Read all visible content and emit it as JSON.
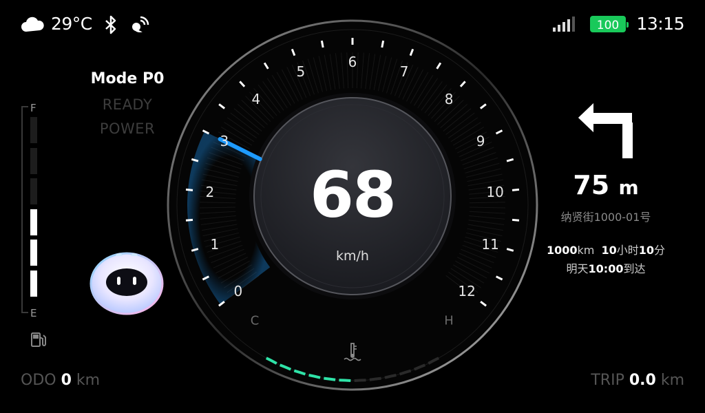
{
  "status": {
    "weather_icon": "cloud-icon",
    "temperature": "29°C",
    "bluetooth_icon": "bluetooth-icon",
    "signal_icon": "satellite-icon",
    "cell_icon": "cell-signal-icon",
    "battery": "100",
    "time": "13:15"
  },
  "drive": {
    "mode": "Mode P0",
    "ready": "READY",
    "power": "POWER"
  },
  "fuel": {
    "full_label": "F",
    "empty_label": "E",
    "level": 0.5,
    "segments_total": 6,
    "segments_on": 3
  },
  "gauge": {
    "speed": "68",
    "unit": "km/h",
    "scale": [
      "0",
      "1",
      "2",
      "3",
      "4",
      "5",
      "6",
      "7",
      "8",
      "9",
      "10",
      "11",
      "12"
    ],
    "needle_value": 3,
    "temp_cold": "C",
    "temp_hot": "H",
    "temp_level": 0.5
  },
  "odometer": {
    "label": "ODO",
    "value": "0",
    "unit": "km"
  },
  "trip": {
    "label": "TRIP",
    "value": "0.0",
    "unit": "km"
  },
  "navigation": {
    "turn_icon": "turn-left-arrow-icon",
    "distance_value": "75",
    "distance_unit": "m",
    "street": "纳贤街1000-01号",
    "remaining_km": "1000",
    "km_unit": "km",
    "hours": "10",
    "hours_unit": "小时",
    "minutes": "10",
    "minutes_unit": "分",
    "arrive_prefix": "明天",
    "arrive_time": "10:00",
    "arrive_suffix": "到达"
  },
  "colors": {
    "accent_blue": "#1e9bff",
    "temp_green": "#2fe3a8",
    "battery_green": "#19c95a"
  }
}
